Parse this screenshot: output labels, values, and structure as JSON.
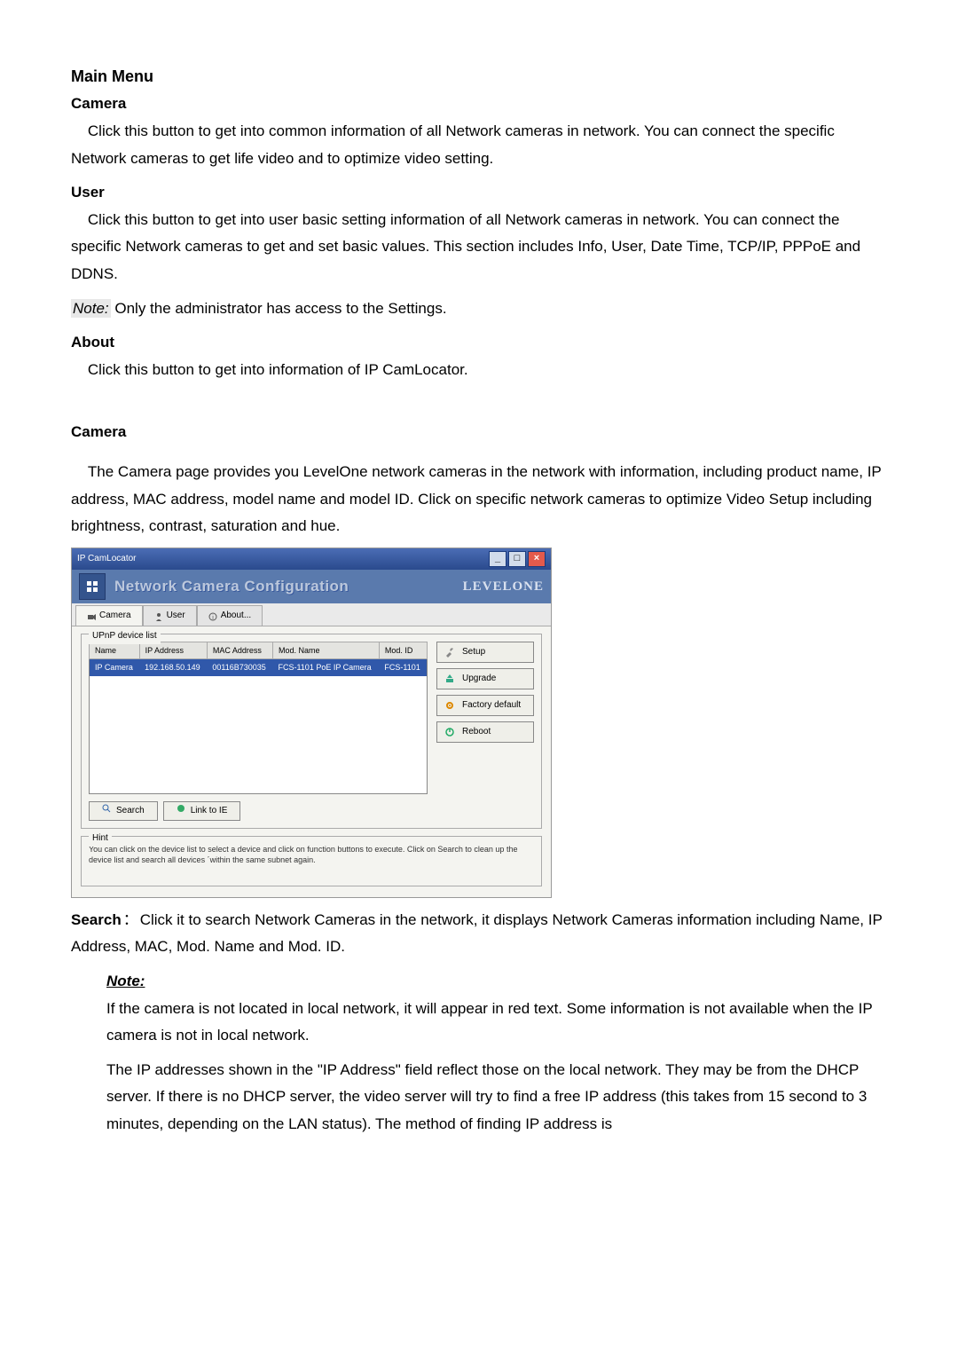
{
  "doc": {
    "main_menu_title": "Main Menu",
    "camera_title": "Camera",
    "camera_para": "    Click this button to get into common information of all Network cameras in network. You can connect the specific Network cameras to get life video and to optimize video setting.",
    "user_title": "User",
    "user_para": "    Click this button to get into user basic setting information of all Network cameras in network. You can connect the specific Network cameras to get and set basic values. This section includes Info, User, Date Time, TCP/IP, PPPoE and DDNS.",
    "note_label": "Note:",
    "note_admin": " Only the administrator has access to the Settings.",
    "about_title": "About",
    "about_para": "    Click this button to get into information of IP CamLocator.",
    "camera2_title": "Camera",
    "camera2_para": "    The Camera page provides you LevelOne network cameras in the network with information, including product name, IP address, MAC address, model name and model ID. Click on specific network cameras to optimize Video Setup including brightness, contrast, saturation and hue.",
    "search_label": "Search",
    "colon": "：",
    "search_desc": "Click it to search Network Cameras in the network, it displays Network Cameras information including Name, IP Address, MAC, Mod. Name and Mod. ID.",
    "note2_label": "Note:",
    "note2_p1": "If the camera is not located in local network, it will appear in red text. Some information is not available when the IP camera is not in local network.",
    "note2_p2": "The IP addresses shown in the \"IP Address\" field reflect those on the local network. They may be from the DHCP server. If there is no DHCP server, the video server will try to find a free IP address (this takes from 15 second to 3 minutes, depending on the LAN status). The method of finding IP address is"
  },
  "app": {
    "window_title": "IP CamLocator",
    "header_title": "Network Camera Configuration",
    "brand": "LEVELONE",
    "tabs": {
      "camera": "Camera",
      "user": "User",
      "about": "About..."
    },
    "group_label": "UPnP device list",
    "columns": {
      "name": "Name",
      "ip": "IP Address",
      "mac": "MAC Address",
      "modname": "Mod. Name",
      "modid": "Mod. ID"
    },
    "row": {
      "name": "IP Camera",
      "ip": "192.168.50.149",
      "mac": "00116B730035",
      "modname": "FCS-1101 PoE IP Camera",
      "modid": "FCS-1101"
    },
    "side": {
      "setup": "Setup",
      "upgrade": "Upgrade",
      "factory": "Factory default",
      "reboot": "Reboot"
    },
    "bottom": {
      "search": "Search",
      "link": "Link to IE"
    },
    "hint_label": "Hint",
    "hint_text": "You can click on the device list to select a device and click on function buttons to execute. Click on Search to clean up the device list and search all devices ´within the same subnet again."
  }
}
